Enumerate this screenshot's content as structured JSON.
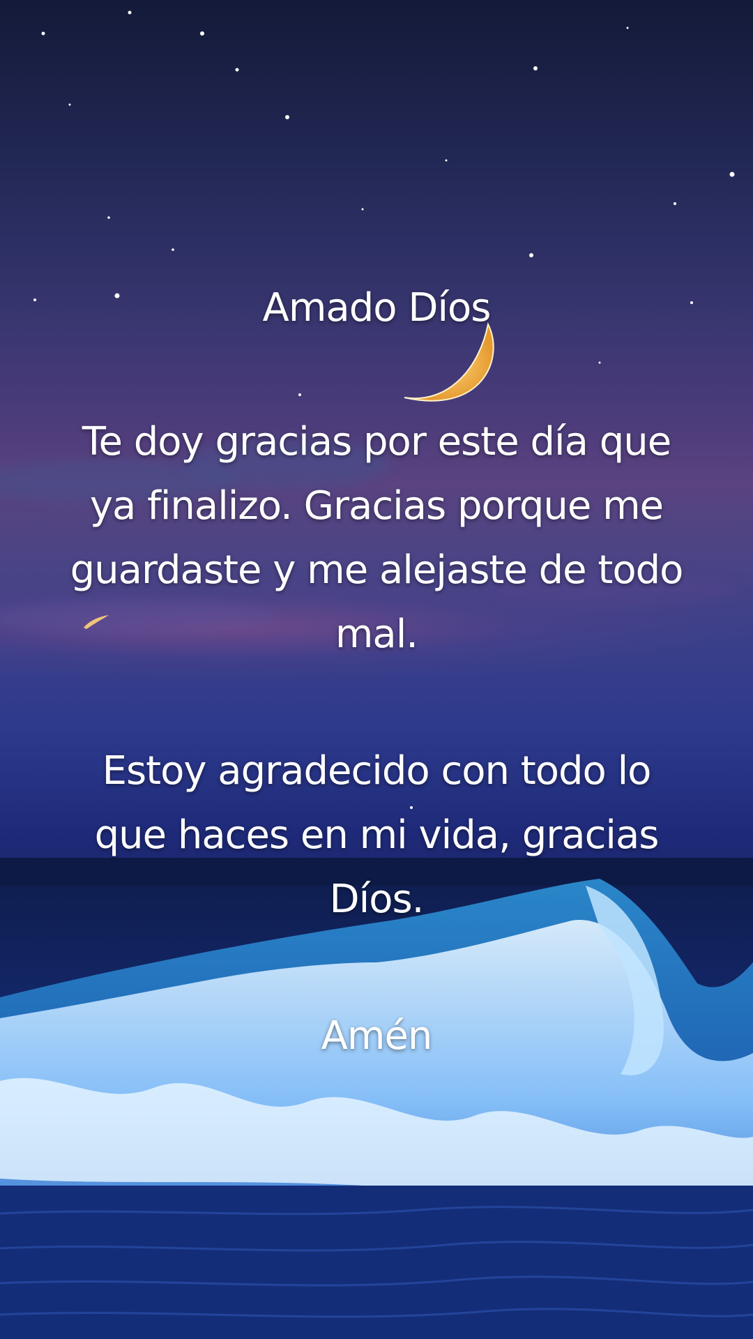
{
  "post": {
    "title": "Amado Díos",
    "paragraph1": [
      "Te doy gracias por este día que",
      "ya finalizo. Gracias porque me",
      "guardaste y me alejaste de todo",
      "mal."
    ],
    "paragraph2": [
      "Estoy agradecido con todo lo",
      "que haces en mi vida, gracias",
      "Díos."
    ],
    "closing": "Amén"
  },
  "scene": {
    "background": "night-sky-over-ocean",
    "icons": [
      "crescent-moon-icon",
      "shooting-star-icon",
      "stars",
      "ocean-wave"
    ],
    "colors": {
      "sky_top": "#141a38",
      "sky_mid": "#4b3b7a",
      "sea": "#183080",
      "foam": "#cfe6ff",
      "moon": "#f0b04a",
      "text": "#ffffff"
    }
  }
}
